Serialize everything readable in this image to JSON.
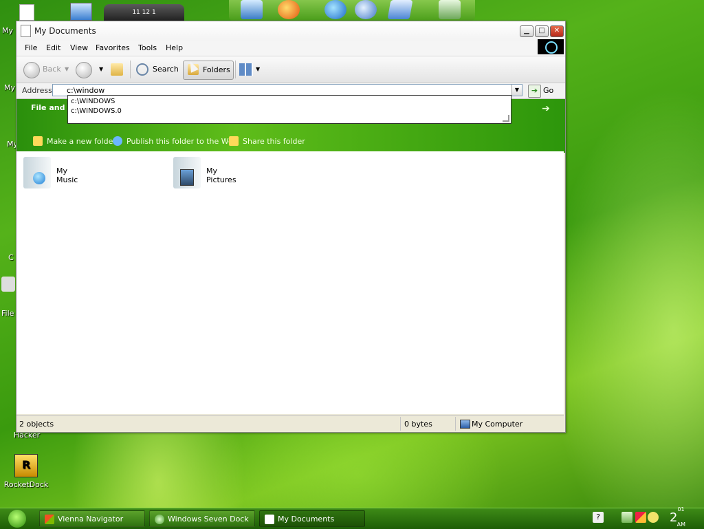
{
  "desktop": {
    "icons": [
      {
        "label": "Hacker",
        "name": "resource-hacker"
      },
      {
        "label": "RocketDock",
        "name": "rocketdock"
      }
    ],
    "edge_labels": [
      "My",
      "My",
      "My",
      "C",
      "File"
    ]
  },
  "window": {
    "title": "My Documents",
    "menu": [
      "File",
      "Edit",
      "View",
      "Favorites",
      "Tools",
      "Help"
    ],
    "toolbar": {
      "back": "Back",
      "search": "Search",
      "folders": "Folders"
    },
    "address": {
      "label": "Address",
      "value": "c:\\window",
      "go": "Go",
      "suggestions": [
        "c:\\WINDOWS",
        "c:\\WINDOWS.0"
      ]
    },
    "task_pane": {
      "title": "File and F",
      "tasks": [
        "Make a new folder",
        "Publish this folder to the Web",
        "Share this folder"
      ]
    },
    "items": [
      {
        "label": "My Music"
      },
      {
        "label": "My Pictures"
      }
    ],
    "status": {
      "objects": "2 objects",
      "size": "0 bytes",
      "zone": "My Computer"
    }
  },
  "taskbar": {
    "buttons": [
      "Vienna Navigator",
      "Windows Seven Dock",
      "My Documents"
    ],
    "clock": {
      "hour": "2",
      "minutes": "01",
      "ampm": "AM"
    }
  },
  "colors": {
    "accent_green": "#3a9a0e",
    "close_red": "#c43a22"
  }
}
